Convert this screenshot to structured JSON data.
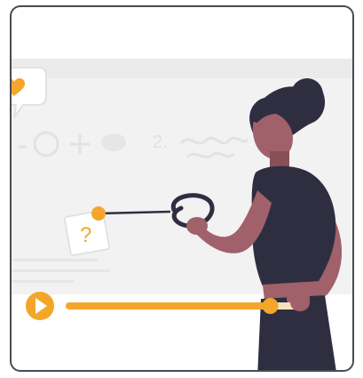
{
  "player": {
    "progress": 0.88,
    "state": "paused",
    "accent_color": "#f4a62a",
    "board_text": "2.",
    "note_text": "?"
  },
  "icons": {
    "play": "play-icon",
    "heart": "heart-icon",
    "question": "question-note-icon"
  },
  "colors": {
    "figure_dark": "#2f2e41",
    "skin": "#a0616a",
    "skin_dark": "#8a4f56",
    "board_bg": "#f2f2f2",
    "line_light": "#e6e6e6"
  }
}
